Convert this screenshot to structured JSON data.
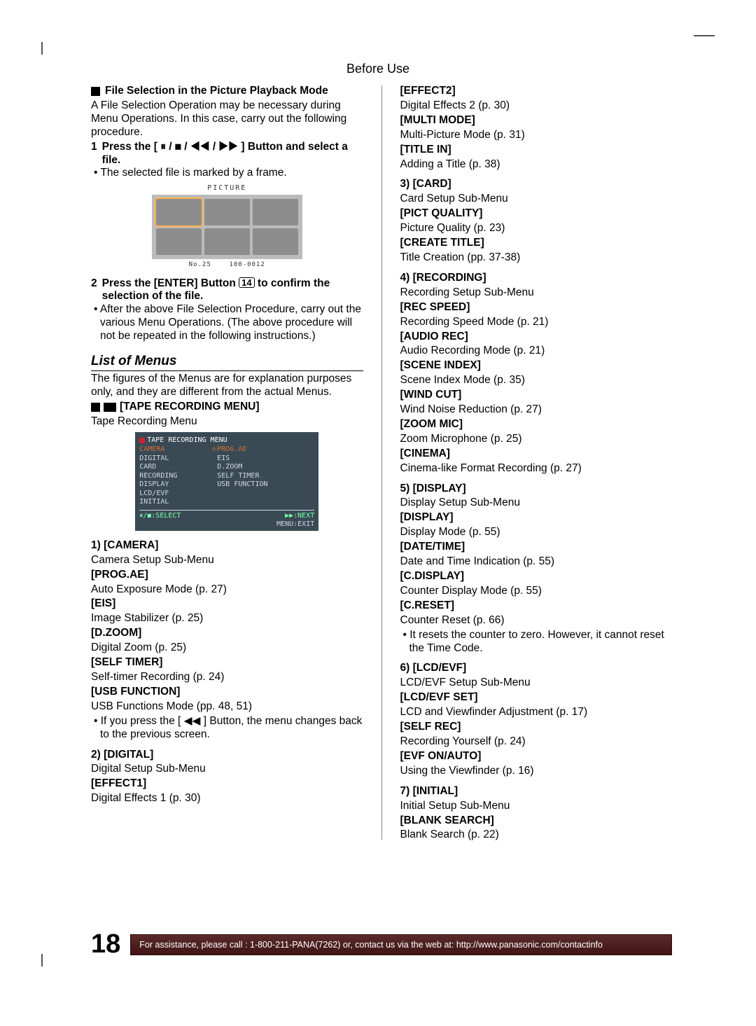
{
  "header": "Before Use",
  "left": {
    "section_title": "File Selection in the Picture Playback Mode",
    "section_body": "A File Selection Operation may be necessary during Menu Operations. In this case, carry out the following procedure.",
    "step1": {
      "num": "1",
      "text_a": "Press the [",
      "text_b": "] Button and select a file.",
      "glyphs": "⏸ / ◼ / ◀◀ / ▶▶",
      "sub": "The selected file is marked by a frame."
    },
    "step2": {
      "num": "2",
      "text_a": "Press the [ENTER] Button",
      "box": "14",
      "text_b": "to confirm the selection of the file.",
      "sub": "After the above File Selection Procedure, carry out the various Menu Operations. (The above procedure will not be repeated in the following instructions.)"
    },
    "pict": {
      "title": "PICTURE",
      "footer_left": "No.25",
      "footer_right": "100-0012"
    },
    "list_h2": "List of Menus",
    "list_body": "The figures of the Menus are for explanation purposes only, and they are different from the actual Menus.",
    "tape_menu_head": "[TAPE RECORDING MENU]",
    "tape_menu_sub": "Tape Recording Menu",
    "osd": {
      "title": "TAPE RECORDING MENU",
      "left_lines": [
        "CAMERA",
        "DIGITAL",
        "CARD",
        "RECORDING",
        "DISPLAY",
        "LCD/EVF",
        "INITIAL"
      ],
      "right_lines": [
        "▷PROG.AE",
        " EIS",
        " D.ZOOM",
        " SELF TIMER",
        " USB FUNCTION"
      ],
      "foot_left": "⏸/◼:SELECT",
      "foot_right_top": "▶▶:NEXT",
      "foot_right_bot": "MENU:EXIT"
    },
    "camera": {
      "title": "1) [CAMERA]",
      "desc": "Camera Setup Sub-Menu",
      "items": [
        {
          "k": "[PROG.AE]",
          "v": "Auto Exposure Mode (p. 27)"
        },
        {
          "k": "[EIS]",
          "v": "Image Stabilizer (p. 25)"
        },
        {
          "k": "[D.ZOOM]",
          "v": "Digital Zoom (p. 25)"
        },
        {
          "k": "[SELF TIMER]",
          "v": "Self-timer Recording (p. 24)"
        },
        {
          "k": "[USB FUNCTION]",
          "v": "USB Functions Mode (pp. 48, 51)"
        }
      ],
      "note": "If you press the [ ◀◀ ] Button, the menu changes back to the previous screen."
    },
    "digital": {
      "title": "2) [DIGITAL]",
      "desc": "Digital Setup Sub-Menu",
      "items": [
        {
          "k": "[EFFECT1]",
          "v": "Digital Effects 1 (p. 30)"
        }
      ]
    }
  },
  "right": {
    "digital_cont": [
      {
        "k": "[EFFECT2]",
        "v": "Digital Effects 2 (p. 30)"
      },
      {
        "k": "[MULTI MODE]",
        "v": "Multi-Picture Mode (p. 31)"
      },
      {
        "k": "[TITLE IN]",
        "v": "Adding a Title (p. 38)"
      }
    ],
    "card": {
      "title": "3) [CARD]",
      "desc": "Card Setup Sub-Menu",
      "items": [
        {
          "k": "[PICT QUALITY]",
          "v": "Picture Quality (p. 23)"
        },
        {
          "k": "[CREATE TITLE]",
          "v": "Title Creation (pp. 37-38)"
        }
      ]
    },
    "recording": {
      "title": "4) [RECORDING]",
      "desc": "Recording Setup Sub-Menu",
      "items": [
        {
          "k": "[REC SPEED]",
          "v": "Recording Speed Mode (p. 21)"
        },
        {
          "k": "[AUDIO REC]",
          "v": "Audio Recording Mode (p. 21)"
        },
        {
          "k": "[SCENE INDEX]",
          "v": "Scene Index Mode (p. 35)"
        },
        {
          "k": "[WIND CUT]",
          "v": "Wind Noise Reduction (p. 27)"
        },
        {
          "k": "[ZOOM MIC]",
          "v": "Zoom Microphone (p. 25)"
        },
        {
          "k": "[CINEMA]",
          "v": "Cinema-like Format Recording (p. 27)"
        }
      ]
    },
    "display": {
      "title": "5) [DISPLAY]",
      "desc": "Display Setup Sub-Menu",
      "items": [
        {
          "k": "[DISPLAY]",
          "v": "Display Mode (p. 55)"
        },
        {
          "k": "[DATE/TIME]",
          "v": "Date and Time Indication (p. 55)"
        },
        {
          "k": "[C.DISPLAY]",
          "v": "Counter Display Mode (p. 55)"
        },
        {
          "k": "[C.RESET]",
          "v": "Counter Reset (p. 66)"
        }
      ],
      "note": "It resets the counter to zero. However, it cannot reset the Time Code."
    },
    "lcd": {
      "title": "6) [LCD/EVF]",
      "desc": "LCD/EVF Setup Sub-Menu",
      "items": [
        {
          "k": "[LCD/EVF SET]",
          "v": "LCD and Viewfinder Adjustment (p. 17)"
        },
        {
          "k": "[SELF REC]",
          "v": "Recording Yourself (p. 24)"
        },
        {
          "k": "[EVF ON/AUTO]",
          "v": "Using the Viewfinder (p. 16)"
        }
      ]
    },
    "initial": {
      "title": "7) [INITIAL]",
      "desc": "Initial Setup Sub-Menu",
      "items": [
        {
          "k": "[BLANK SEARCH]",
          "v": "Blank Search (p. 22)"
        }
      ]
    }
  },
  "footer": {
    "page": "18",
    "assist": "For assistance, please call : 1-800-211-PANA(7262) or, contact us via the web at: http://www.panasonic.com/contactinfo"
  }
}
